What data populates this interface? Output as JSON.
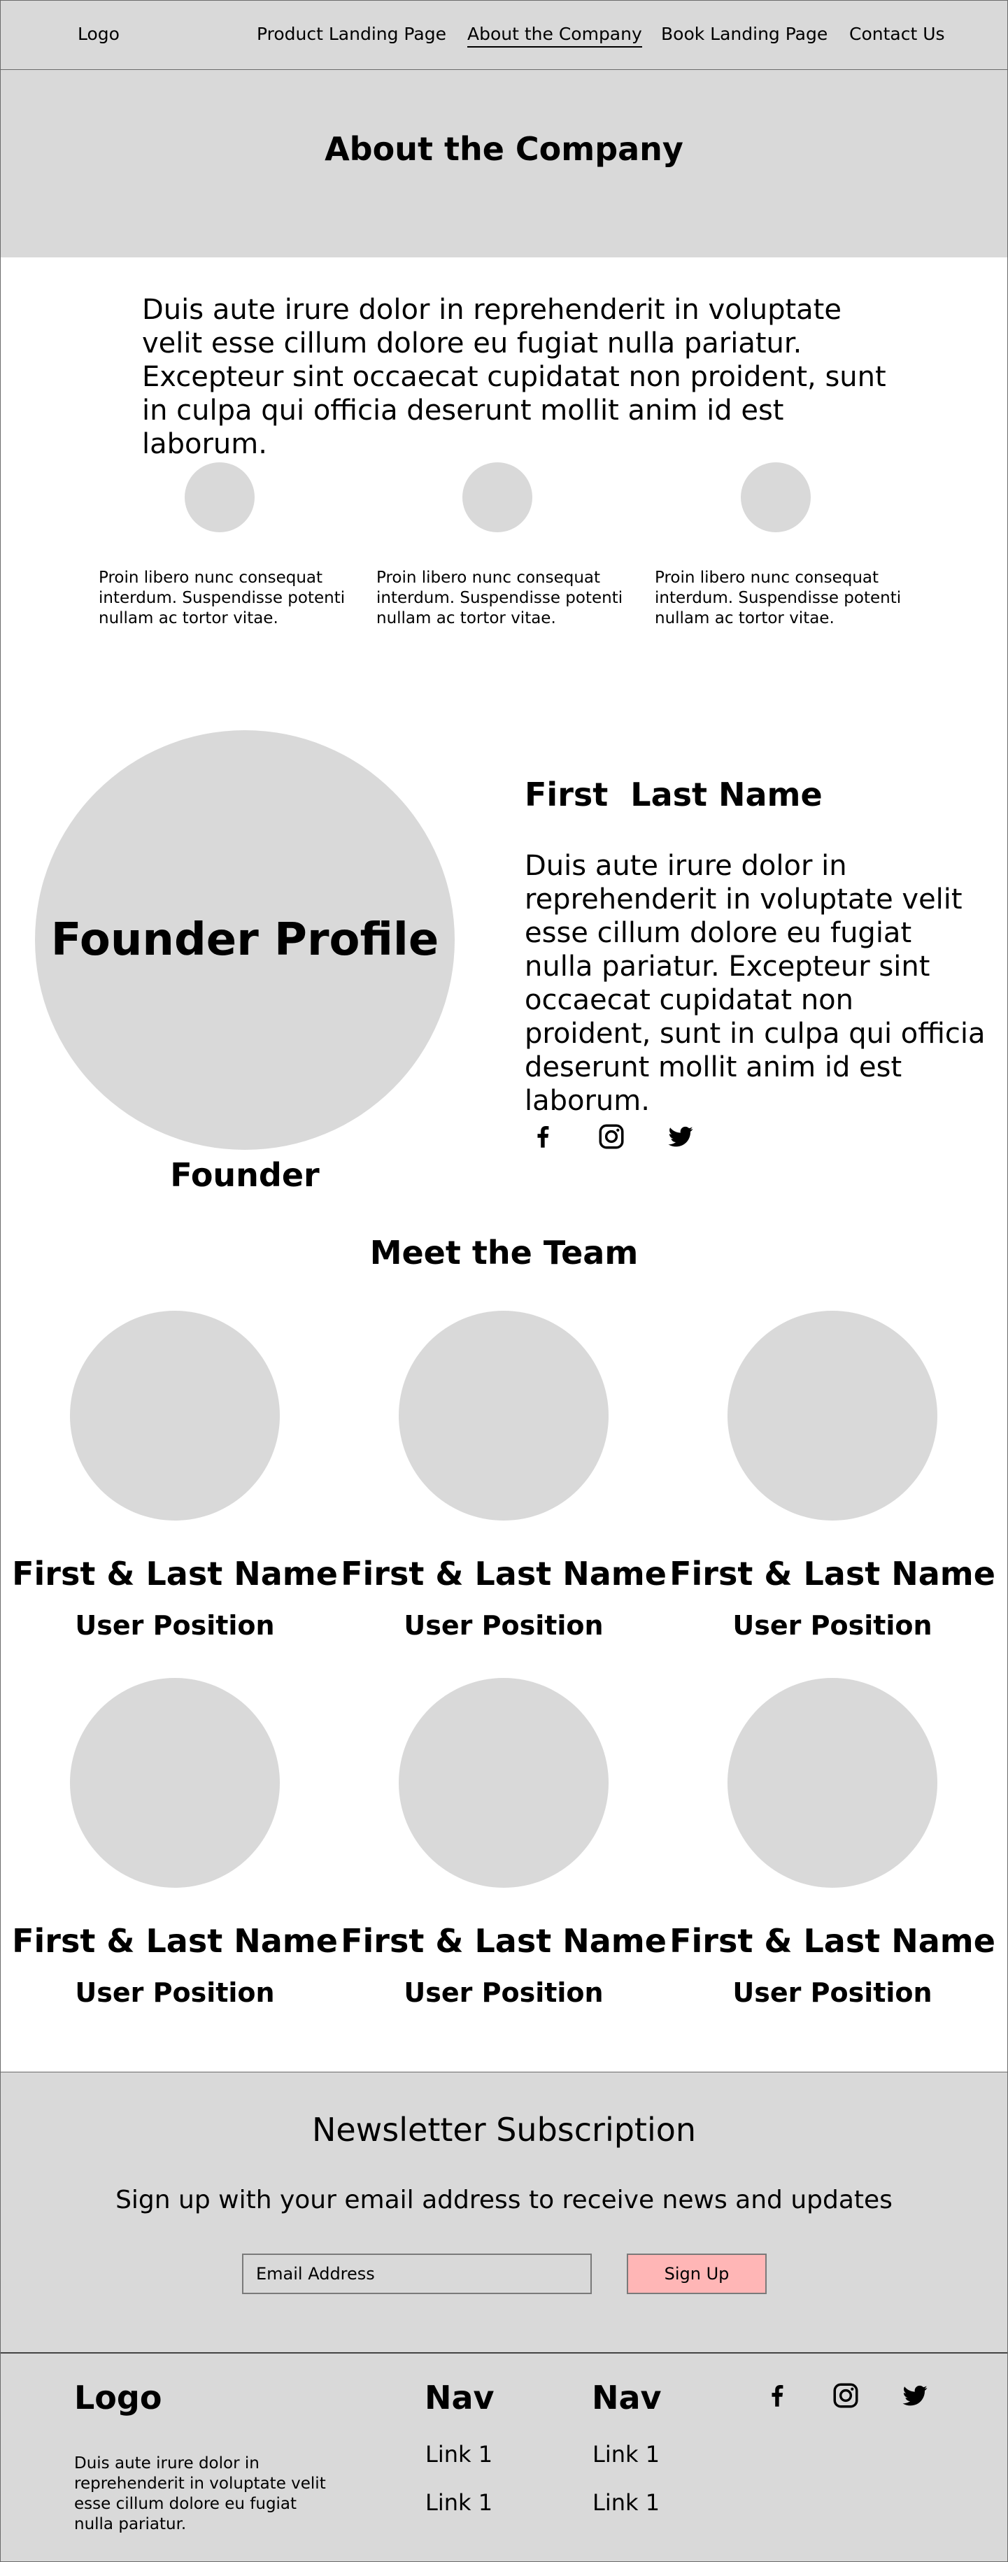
{
  "header": {
    "logo": "Logo",
    "nav": [
      {
        "label": "Product Landing Page"
      },
      {
        "label": "About the Company",
        "active": true
      },
      {
        "label": "Book Landing Page"
      },
      {
        "label": "Contact Us"
      }
    ]
  },
  "hero": {
    "title": "About the Company"
  },
  "intro": {
    "text": "Duis aute irure dolor in reprehenderit in voluptate velit esse cillum dolore eu fugiat nulla pariatur. Excepteur sint occaecat cupidatat non proident, sunt in culpa qui officia deserunt mollit anim id est laborum."
  },
  "features": [
    {
      "text": "Proin libero nunc consequat interdum. Suspendisse potenti nullam ac tortor vitae."
    },
    {
      "text": "Proin libero nunc consequat interdum. Suspendisse potenti nullam ac tortor vitae."
    },
    {
      "text": "Proin libero nunc consequat interdum. Suspendisse potenti nullam ac tortor vitae."
    }
  ],
  "founder": {
    "circle_label": "Founder Profile",
    "caption": "Founder",
    "name": "First  Last Name",
    "bio": "Duis aute irure dolor in reprehenderit in voluptate velit esse cillum dolore eu fugiat nulla pariatur. Excepteur sint occaecat cupidatat non proident, sunt in culpa qui officia deserunt mollit anim id est laborum.",
    "social_icons": [
      "facebook-icon",
      "instagram-icon",
      "twitter-icon"
    ]
  },
  "team": {
    "heading": "Meet the Team",
    "members": [
      {
        "name": "First & Last Name",
        "position": "User Position"
      },
      {
        "name": "First & Last Name",
        "position": "User Position"
      },
      {
        "name": "First & Last Name",
        "position": "User Position"
      },
      {
        "name": "First & Last Name",
        "position": "User Position"
      },
      {
        "name": "First & Last Name",
        "position": "User Position"
      },
      {
        "name": "First & Last Name",
        "position": "User Position"
      }
    ]
  },
  "newsletter": {
    "title": "Newsletter Subscription",
    "subtitle": "Sign up with your email address to receive news and updates",
    "placeholder": "Email Address",
    "button_label": "Sign Up"
  },
  "footer": {
    "logo": "Logo",
    "text": "Duis aute irure dolor in reprehenderit in voluptate velit esse cillum dolore eu fugiat nulla pariatur.",
    "nav_columns": [
      {
        "title": "Nav",
        "links": [
          "Link 1",
          "Link 1"
        ]
      },
      {
        "title": "Nav",
        "links": [
          "Link 1",
          "Link 1"
        ]
      }
    ],
    "social_icons": [
      "facebook-icon",
      "instagram-icon",
      "twitter-icon"
    ]
  },
  "colors": {
    "panel_gray": "#d9d9d9",
    "button_pink": "#ffb6b6",
    "border": "#6b6b6b"
  }
}
